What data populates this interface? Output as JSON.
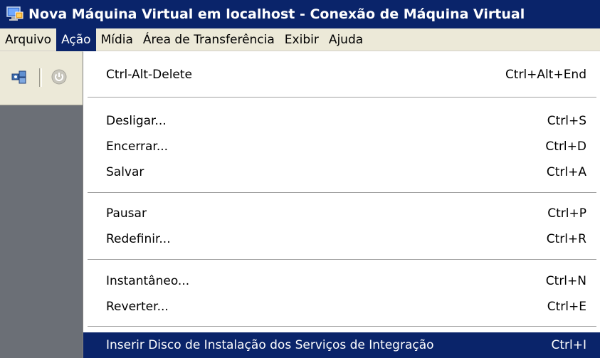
{
  "window": {
    "title": "Nova Máquina Virtual em localhost - Conexão de Máquina Virtual"
  },
  "menubar": {
    "items": [
      {
        "label": "Arquivo"
      },
      {
        "label": "Ação"
      },
      {
        "label": "Mídia"
      },
      {
        "label": "Área de Transferência"
      },
      {
        "label": "Exibir"
      },
      {
        "label": "Ajuda"
      }
    ],
    "active": "Ação"
  },
  "toolbar": {
    "icons": [
      "ctrl-alt-del-icon",
      "power-icon"
    ]
  },
  "action_menu": {
    "items": [
      {
        "label": "Ctrl-Alt-Delete",
        "shortcut": "Ctrl+Alt+End"
      },
      {
        "label": "Desligar...",
        "shortcut": "Ctrl+S"
      },
      {
        "label": "Encerrar...",
        "shortcut": "Ctrl+D"
      },
      {
        "label": "Salvar",
        "shortcut": "Ctrl+A"
      },
      {
        "label": "Pausar",
        "shortcut": "Ctrl+P"
      },
      {
        "label": "Redefinir...",
        "shortcut": "Ctrl+R"
      },
      {
        "label": "Instantâneo...",
        "shortcut": "Ctrl+N"
      },
      {
        "label": "Reverter...",
        "shortcut": "Ctrl+E"
      },
      {
        "label": "Inserir Disco de Instalação dos Serviços de Integração",
        "shortcut": "Ctrl+I"
      }
    ],
    "highlighted": "Inserir Disco de Instalação dos Serviços de Integração"
  },
  "colors": {
    "titlebar": "#0a246a",
    "highlight": "#0a246a",
    "menubar": "#ece9d8",
    "vm_background": "#6b6f76"
  }
}
